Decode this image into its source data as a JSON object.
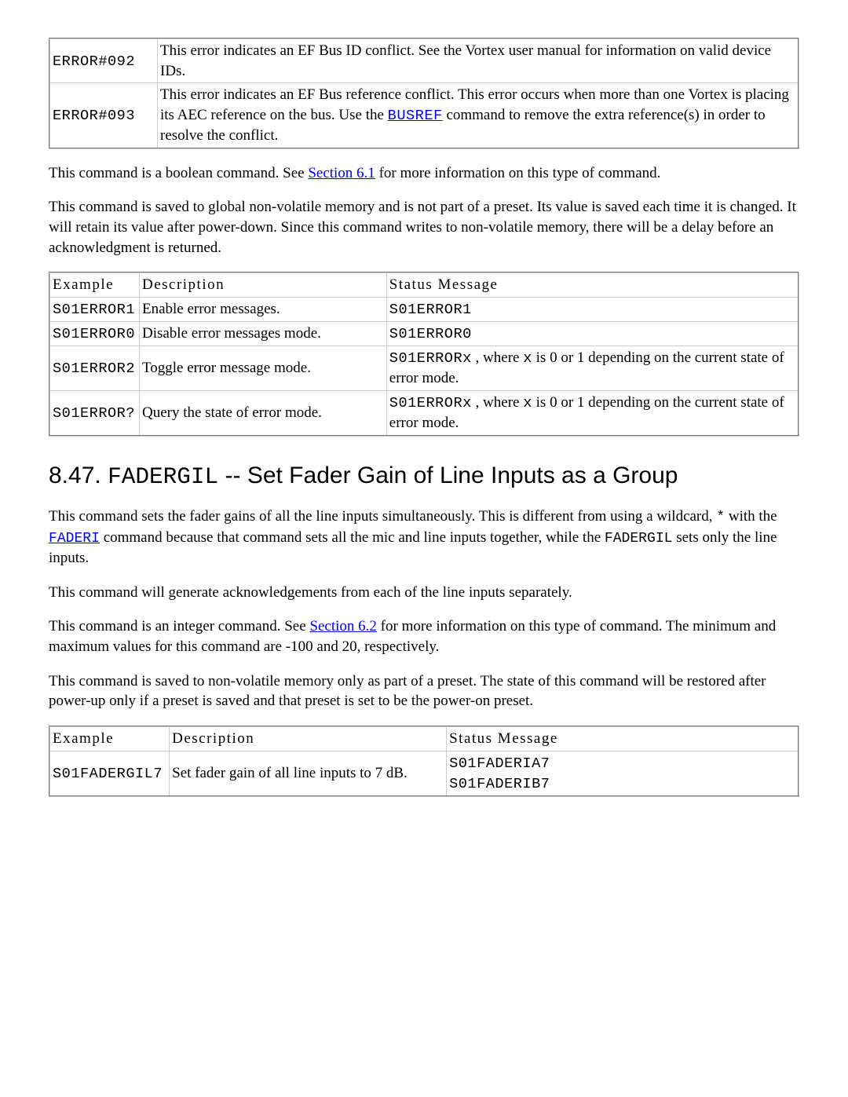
{
  "errors_table": {
    "rows": [
      {
        "code": "ERROR#092",
        "desc": "This error indicates an EF Bus ID conflict. See the Vortex user manual for information on valid device IDs."
      },
      {
        "code": "ERROR#093",
        "desc_prefix": "This error indicates an EF Bus reference conflict. This error occurs when more than one Vortex is placing its AEC reference on the bus. Use the ",
        "desc_link": "BUSREF",
        "desc_suffix": " command to remove the extra reference(s) in order to resolve the conflict."
      }
    ]
  },
  "para_bool": {
    "prefix": "This command is a boolean command. See ",
    "link": "Section 6.1",
    "suffix": " for more information on this type of command."
  },
  "para_global": "This command is saved to global non-volatile memory and is not part of a preset. Its value is saved each time it is changed. It will retain its value after power-down. Since this command writes to non-volatile memory, there will be a delay before an acknowledgment is returned.",
  "examples_table": {
    "headers": {
      "c1": "Example",
      "c2": "Description",
      "c3": "Status Message"
    },
    "rows": [
      {
        "ex": "S01ERROR1",
        "desc": "Enable error messages.",
        "status": "S01ERROR1"
      },
      {
        "ex": "S01ERROR0",
        "desc": "Disable error messages mode.",
        "status": "S01ERROR0"
      },
      {
        "ex": "S01ERROR2",
        "desc": "Toggle error message mode.",
        "status_code": "S01ERRORx",
        "status_mid": " , where ",
        "status_var": "x",
        "status_suffix": " is 0 or 1 depending on the current state of error mode."
      },
      {
        "ex": "S01ERROR?",
        "desc": "Query the state of error mode.",
        "status_code": "S01ERRORx",
        "status_mid": " , where ",
        "status_var": "x",
        "status_suffix": " is 0 or 1 depending on the current state of error mode."
      }
    ]
  },
  "heading_847": {
    "num": "8.47. ",
    "cmd": "FADERGIL",
    "suffix": " -- Set Fader Gain of Line Inputs as a Group"
  },
  "para_fader_intro": {
    "prefix": "This command sets the fader gains of all the line inputs simultaneously. This is different from using a wildcard, ",
    "wild": "*",
    "mid1": " with the ",
    "link": "FADERI",
    "mid2": " command because that command sets all the mic and line inputs together, while the ",
    "cmd": "FADERGIL",
    "suffix": " sets only the line inputs."
  },
  "para_ack": "This command will generate acknowledgements from each of the line inputs separately.",
  "para_int": {
    "prefix": "This command is an integer command. See ",
    "link": "Section 6.2",
    "suffix": " for more information on this type of command. The minimum and maximum values for this command are -100 and 20, respectively."
  },
  "para_preset": "This command is saved to non-volatile memory only as part of a preset. The state of this command will be restored after power-up only if a preset is saved and that preset is set to be the power-on preset.",
  "fader_table": {
    "headers": {
      "c1": "Example",
      "c2": "Description",
      "c3": "Status Message"
    },
    "rows": [
      {
        "ex": "S01FADERGIL7",
        "desc": "Set fader gain of all line inputs to 7 dB.",
        "status1": "S01FADERIA7",
        "status2": "S01FADERIB7"
      }
    ]
  }
}
